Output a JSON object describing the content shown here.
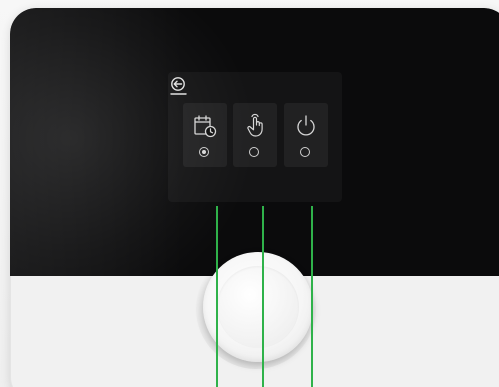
{
  "screen": {
    "back_button": {
      "icon": "back-arrow-icon"
    },
    "modes": [
      {
        "id": "schedule",
        "icon": "calendar-clock-icon",
        "selected": true
      },
      {
        "id": "manual",
        "icon": "touch-hand-icon",
        "selected": false
      },
      {
        "id": "off",
        "icon": "power-icon",
        "selected": false
      }
    ]
  },
  "colors": {
    "screen": "#0b0b0c",
    "icon": "#d6d6d6",
    "guide_line": "#2fb24a",
    "body": "#f1f1f1"
  },
  "controls": {
    "knob": "rotary-dial"
  }
}
